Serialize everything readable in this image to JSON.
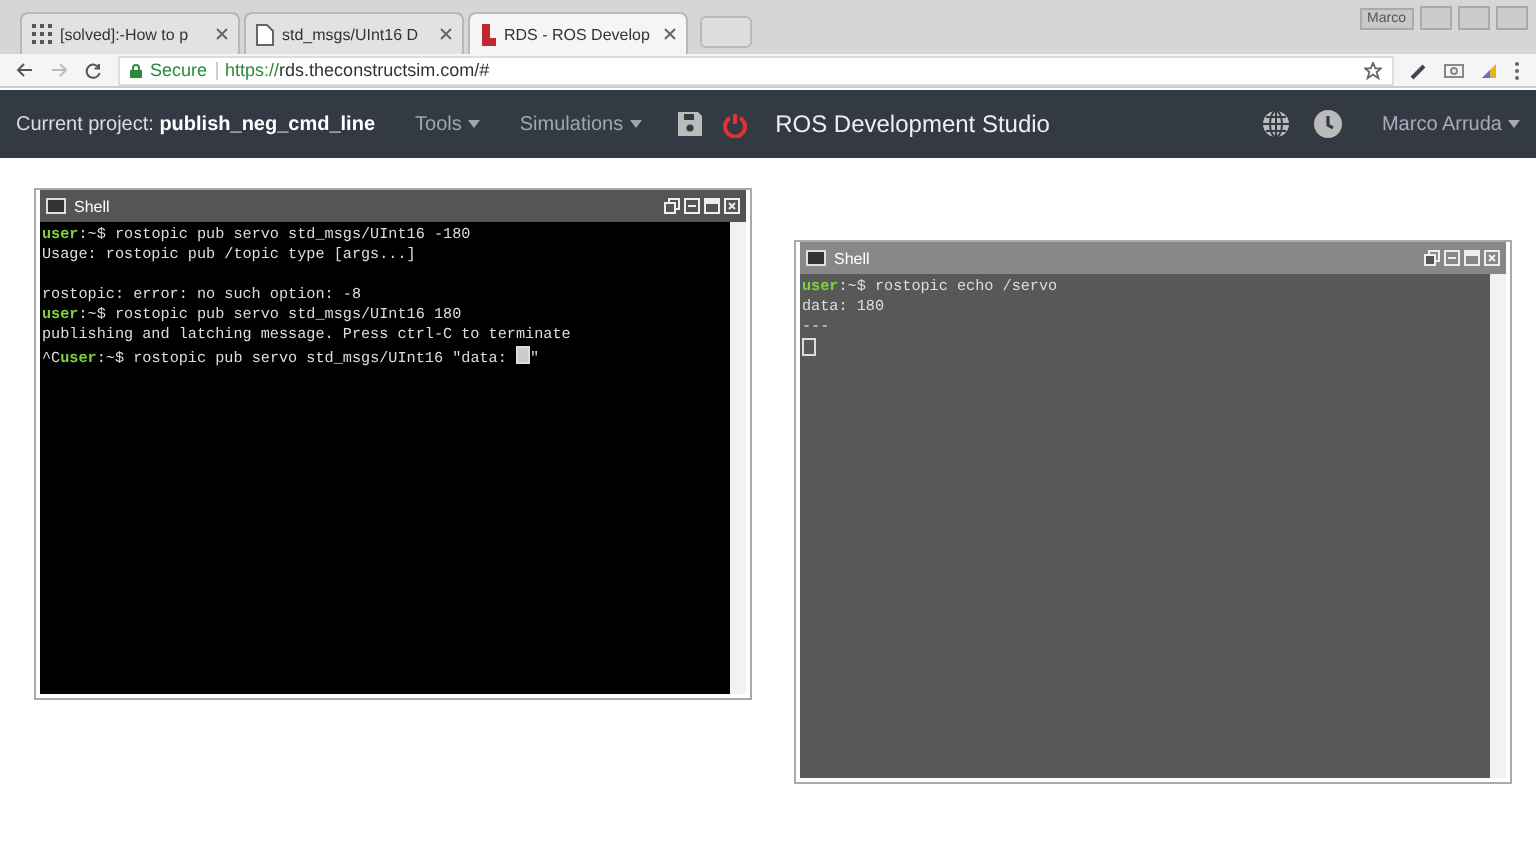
{
  "browser": {
    "tabs": [
      {
        "label": "[solved]:-How to p",
        "selected": false
      },
      {
        "label": "std_msgs/UInt16 D",
        "selected": false
      },
      {
        "label": "RDS - ROS Develop",
        "selected": true
      }
    ],
    "profile": "Marco",
    "secure": "Secure",
    "url_scheme": "https://",
    "url_rest": "rds.theconstructsim.com/#"
  },
  "navbar": {
    "project_label": "Current project:",
    "project_name": "publish_neg_cmd_line",
    "menus": [
      "Tools",
      "Simulations"
    ],
    "app_title": "ROS Development Studio",
    "user": "Marco Arruda"
  },
  "shells": [
    {
      "title": "Shell",
      "lines": [
        [
          {
            "kind": "prompt",
            "text": "user"
          },
          {
            "kind": "plain",
            "text": ":~$ rostopic pub servo std_msgs/UInt16 -180"
          }
        ],
        [
          {
            "kind": "plain",
            "text": "Usage: rostopic pub /topic type [args...]"
          }
        ],
        [
          {
            "kind": "gap"
          },
          {
            "kind": "plain",
            "text": "rostopic: error: no such option: -8"
          }
        ],
        [
          {
            "kind": "prompt",
            "text": "user"
          },
          {
            "kind": "plain",
            "text": ":~$ rostopic pub servo std_msgs/UInt16 180"
          }
        ],
        [
          {
            "kind": "plain",
            "text": "publishing and latching message. Press ctrl-C to terminate"
          }
        ],
        [
          {
            "kind": "plain",
            "text": "^C"
          },
          {
            "kind": "prompt",
            "text": "user"
          },
          {
            "kind": "plain",
            "text": ":~$ rostopic pub servo std_msgs/UInt16 \"data: "
          },
          {
            "kind": "cursor"
          },
          {
            "kind": "plain",
            "text": "\""
          }
        ]
      ]
    },
    {
      "title": "Shell",
      "lines": [
        [
          {
            "kind": "prompt",
            "text": "user"
          },
          {
            "kind": "plain",
            "text": ":~$ rostopic echo /servo"
          }
        ],
        [
          {
            "kind": "plain",
            "text": "data: 180"
          }
        ],
        [
          {
            "kind": "plain",
            "text": "---"
          }
        ],
        [
          {
            "kind": "cursor"
          }
        ]
      ]
    }
  ]
}
